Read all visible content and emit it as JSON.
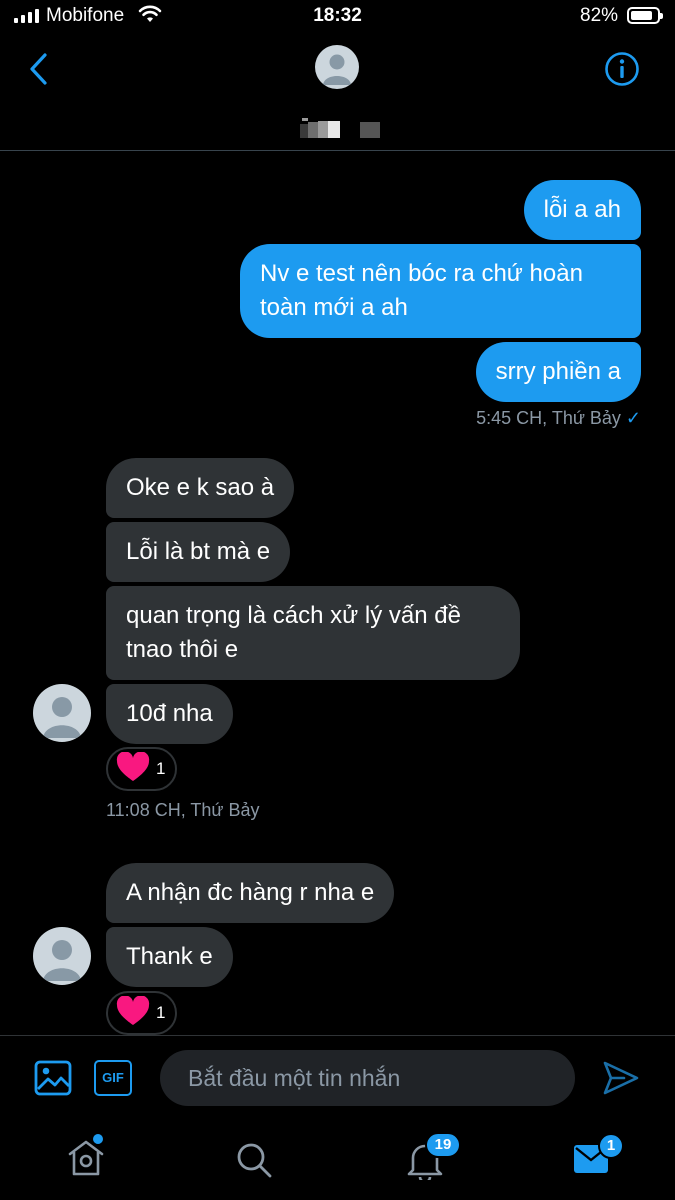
{
  "status_bar": {
    "carrier": "Mobifone",
    "time": "18:32",
    "battery": "82%",
    "battery_level": 0.82
  },
  "header": {
    "back_icon": "chevron-left-icon",
    "info_icon": "info-icon"
  },
  "messages": {
    "sent": [
      {
        "text": "lỗi a ah"
      },
      {
        "lines": [
          "Nv e test nên bóc ra chứ hoàn",
          "toàn mới a ah"
        ]
      },
      {
        "text": "srry phiền a"
      }
    ],
    "sent_meta": "5:45 CH, Thứ Bảy ✓",
    "received_1": [
      {
        "text": "Oke e k sao à"
      },
      {
        "text": "Lỗi là bt mà e"
      },
      {
        "lines": [
          "quan trọng là cách xử lý vấn đề",
          "tnao thôi e"
        ]
      },
      {
        "text": "10đ nha"
      }
    ],
    "reaction_1": {
      "icon": "heart-icon",
      "count": "1"
    },
    "received_1_meta": "11:08 CH, Thứ Bảy",
    "received_2": [
      {
        "text": "A nhận đc hàng r nha e"
      },
      {
        "text": "Thank e"
      }
    ],
    "reaction_2": {
      "icon": "heart-icon",
      "count": "1"
    }
  },
  "composer": {
    "placeholder": "Bắt đầu một tin nhắn",
    "gif_label": "GIF"
  },
  "tabbar": {
    "notifications_badge": "19",
    "messages_badge": "1"
  },
  "colors": {
    "accent": "#1d9bf0",
    "incoming_bubble": "#2f3336",
    "heart": "#f91880"
  }
}
